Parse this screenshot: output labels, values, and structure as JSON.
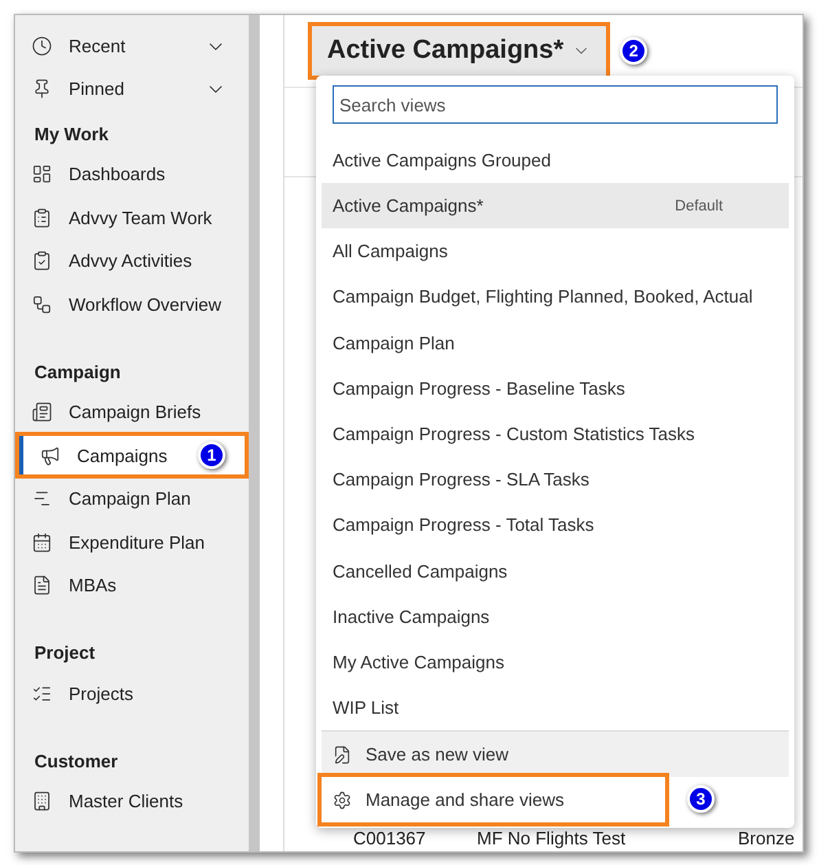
{
  "sidebar": {
    "items": [
      {
        "kind": "expander",
        "label": "Recent",
        "expanded": false
      },
      {
        "kind": "expander",
        "label": "Pinned",
        "expanded": false
      },
      {
        "kind": "heading",
        "label": "My Work"
      },
      {
        "kind": "link",
        "label": "Dashboards",
        "selected": false
      },
      {
        "kind": "link",
        "label": "Advvy Team Work",
        "selected": false
      },
      {
        "kind": "link",
        "label": "Advvy Activities",
        "selected": false
      },
      {
        "kind": "link",
        "label": "Workflow Overview",
        "selected": false
      },
      {
        "kind": "heading",
        "label": "Campaign"
      },
      {
        "kind": "link",
        "label": "Campaign Briefs",
        "selected": false
      },
      {
        "kind": "link",
        "label": "Campaigns",
        "selected": true,
        "callout": "1"
      },
      {
        "kind": "link",
        "label": "Campaign Plan",
        "selected": false
      },
      {
        "kind": "link",
        "label": "Expenditure Plan",
        "selected": false
      },
      {
        "kind": "link",
        "label": "MBAs",
        "selected": false
      },
      {
        "kind": "heading",
        "label": "Project"
      },
      {
        "kind": "link",
        "label": "Projects",
        "selected": false
      },
      {
        "kind": "heading",
        "label": "Customer"
      },
      {
        "kind": "link",
        "label": "Master Clients",
        "selected": false
      }
    ]
  },
  "view_selector": {
    "title": "Active Campaigns*",
    "callout": "2",
    "expanded": true
  },
  "grid": {
    "row": [
      "C001367",
      "MF No Flights Test",
      "Bronze"
    ]
  },
  "views_menu": {
    "search": {
      "placeholder": "Search views"
    },
    "views": [
      {
        "label": "Active Campaigns Grouped",
        "selected": false
      },
      {
        "label": "Active Campaigns*",
        "selected": true,
        "badge": "Default"
      },
      {
        "label": "All Campaigns",
        "selected": false
      },
      {
        "label": "Campaign Budget, Flighting Planned, Booked, Actual",
        "selected": false
      },
      {
        "label": "Campaign Plan",
        "selected": false
      },
      {
        "label": "Campaign Progress - Baseline Tasks",
        "selected": false
      },
      {
        "label": "Campaign Progress - Custom Statistics Tasks",
        "selected": false
      },
      {
        "label": "Campaign Progress - SLA Tasks",
        "selected": false
      },
      {
        "label": "Campaign Progress - Total Tasks",
        "selected": false
      },
      {
        "label": "Cancelled Campaigns",
        "selected": false
      },
      {
        "label": "Inactive Campaigns",
        "selected": false
      },
      {
        "label": "My Active Campaigns",
        "selected": false
      },
      {
        "label": "WIP List",
        "selected": false
      }
    ],
    "actions": [
      {
        "label": "Save as new view"
      },
      {
        "label": "Manage and share views",
        "callout": "3"
      }
    ]
  }
}
